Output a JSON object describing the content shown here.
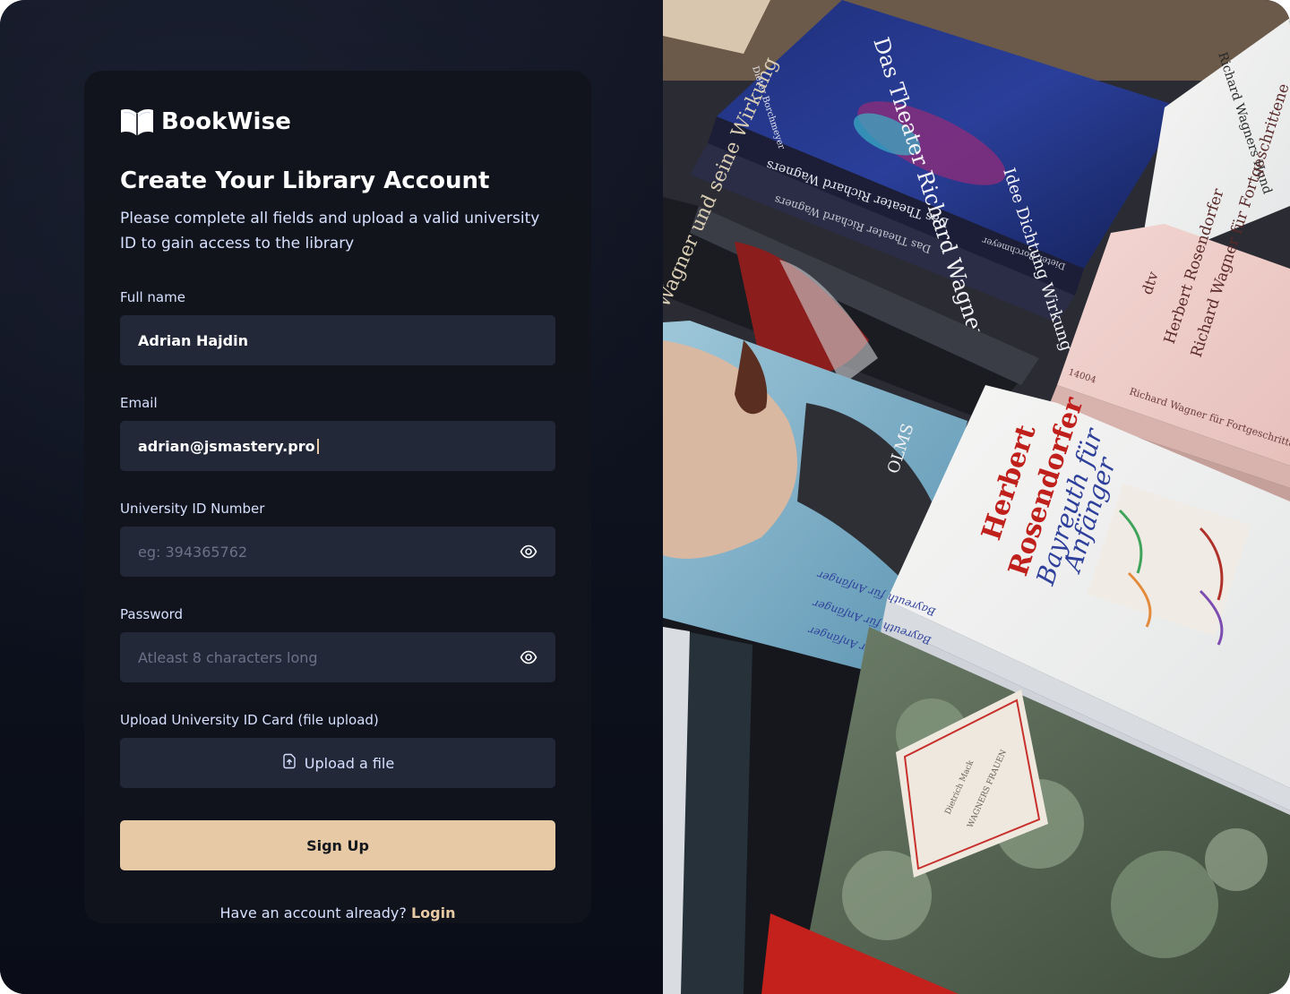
{
  "brand": {
    "name": "BookWise",
    "logo_icon": "open-book-icon"
  },
  "heading": {
    "title": "Create Your Library Account",
    "subtitle": "Please complete all fields and upload a valid university ID to gain access to the library"
  },
  "form": {
    "full_name": {
      "label": "Full name",
      "value": "Adrian Hajdin"
    },
    "email": {
      "label": "Email",
      "value": "adrian@jsmastery.pro"
    },
    "university_id": {
      "label": "University ID Number",
      "placeholder": "eg: 394365762",
      "icon": "eye-icon"
    },
    "password": {
      "label": "Password",
      "placeholder": "Atleast 8 characters long",
      "icon": "eye-icon"
    },
    "id_card_upload": {
      "label": "Upload University ID Card (file upload)",
      "button_label": "Upload a file",
      "icon": "file-upload-icon"
    },
    "submit_label": "Sign Up"
  },
  "footer": {
    "prompt": "Have an account already?",
    "login_label": "Login"
  },
  "colors": {
    "accent": "#E7C9A5",
    "card_bg": "#12141D",
    "input_bg": "#232839",
    "label_text": "#D6E0FF"
  },
  "illustration": {
    "book_titles": {
      "wagner_top": "Das Theater Richard Wagners",
      "wagner_sub": "Idee Dichtung Wirkung",
      "author_bortschmeyer": "Dieter Borchmeyer",
      "spine_1": "Das Theater Richard Wagners",
      "spine_2": "Das Theater Richard Wagners",
      "spine_3": "Dieter Borchmeyer",
      "wagner_wirkung": "Wagner und seine Wirkung",
      "olms": "OLMS",
      "dtv": "dtv",
      "rosendorfer_authors": "Herbert Rosendorfer",
      "rosendorfer_title": "Richard Wagner für Fortgeschrittene",
      "spine_pink": "Richard Wagner für Fortgeschrittene",
      "number": "14004",
      "herbert": "Herbert",
      "rosendorfer": "Rosendorfer",
      "bayreuth": "Bayreuth für",
      "anfaenger": "Anfänger",
      "spine_bayreuth_1": "Bayreuth für Anfänger",
      "spine_bayreuth_2": "Bayreuth für Anfänger",
      "spine_bayreuth_3": "Bayreuth für Anfänger",
      "mack": "Dietrich Mack",
      "wagners_frauen": "WAGNERS FRAUEN",
      "richard_wagner_hund": "Richard Wagners Hund"
    }
  }
}
